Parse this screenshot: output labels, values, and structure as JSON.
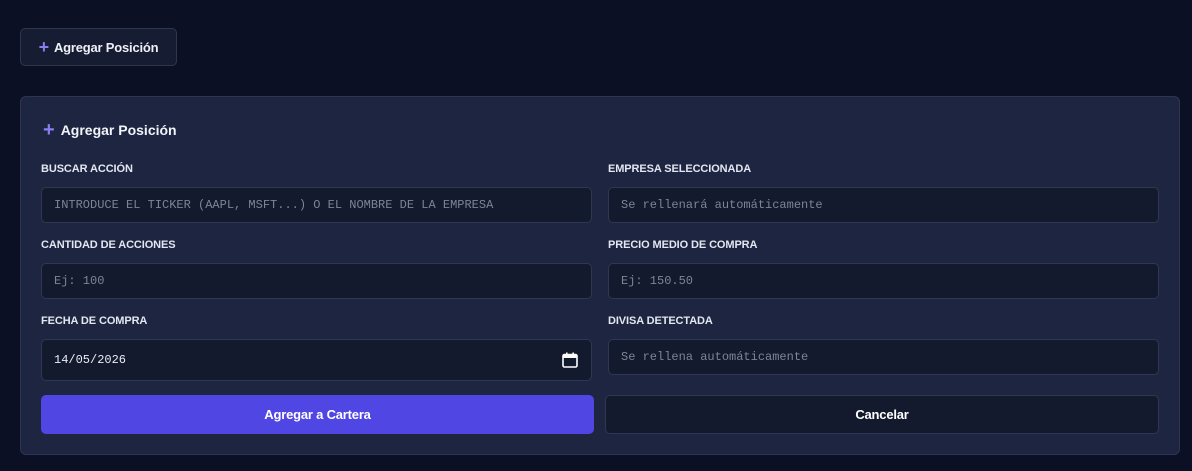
{
  "top_button": {
    "icon": "plus-icon",
    "label": "Agregar Posición"
  },
  "panel": {
    "title": "Agregar Posición",
    "fields": {
      "buscar": {
        "label": "BUSCAR ACCIÓN",
        "placeholder": "INTRODUCE EL TICKER (AAPL, MSFT...) O EL NOMBRE DE LA EMPRESA",
        "value": ""
      },
      "empresa": {
        "label": "EMPRESA SELECCIONADA",
        "placeholder": "Se rellenará automáticamente",
        "value": ""
      },
      "cantidad": {
        "label": "CANTIDAD DE ACCIONES",
        "placeholder": "Ej: 100",
        "value": ""
      },
      "precio": {
        "label": "PRECIO MEDIO DE COMPRA",
        "placeholder": "Ej: 150.50",
        "value": ""
      },
      "fecha": {
        "label": "FECHA DE COMPRA",
        "value": "14/05/2026"
      },
      "divisa": {
        "label": "DIVISA DETECTADA",
        "placeholder": "Se rellena automáticamente",
        "value": ""
      }
    },
    "buttons": {
      "submit": "Agregar a Cartera",
      "cancel": "Cancelar"
    }
  },
  "colors": {
    "background": "#0b1024",
    "panel": "#1d2540",
    "accent": "#5046e4",
    "plus_icon": "#8b7cf0"
  }
}
